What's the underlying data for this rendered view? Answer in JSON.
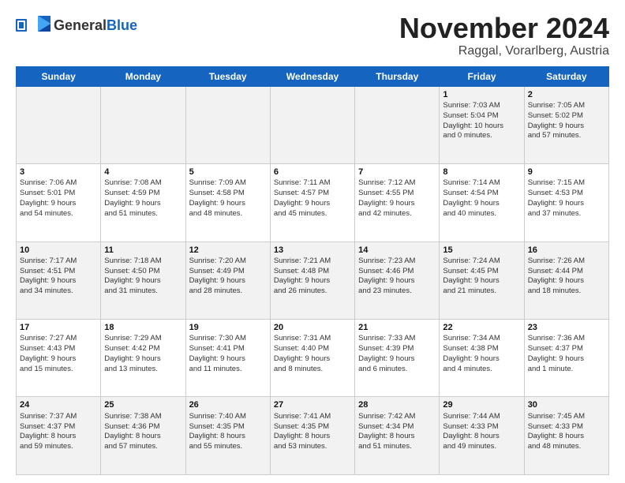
{
  "header": {
    "logo_general": "General",
    "logo_blue": "Blue",
    "month": "November 2024",
    "location": "Raggal, Vorarlberg, Austria"
  },
  "weekdays": [
    "Sunday",
    "Monday",
    "Tuesday",
    "Wednesday",
    "Thursday",
    "Friday",
    "Saturday"
  ],
  "weeks": [
    [
      {
        "day": "",
        "info": ""
      },
      {
        "day": "",
        "info": ""
      },
      {
        "day": "",
        "info": ""
      },
      {
        "day": "",
        "info": ""
      },
      {
        "day": "",
        "info": ""
      },
      {
        "day": "1",
        "info": "Sunrise: 7:03 AM\nSunset: 5:04 PM\nDaylight: 10 hours\nand 0 minutes."
      },
      {
        "day": "2",
        "info": "Sunrise: 7:05 AM\nSunset: 5:02 PM\nDaylight: 9 hours\nand 57 minutes."
      }
    ],
    [
      {
        "day": "3",
        "info": "Sunrise: 7:06 AM\nSunset: 5:01 PM\nDaylight: 9 hours\nand 54 minutes."
      },
      {
        "day": "4",
        "info": "Sunrise: 7:08 AM\nSunset: 4:59 PM\nDaylight: 9 hours\nand 51 minutes."
      },
      {
        "day": "5",
        "info": "Sunrise: 7:09 AM\nSunset: 4:58 PM\nDaylight: 9 hours\nand 48 minutes."
      },
      {
        "day": "6",
        "info": "Sunrise: 7:11 AM\nSunset: 4:57 PM\nDaylight: 9 hours\nand 45 minutes."
      },
      {
        "day": "7",
        "info": "Sunrise: 7:12 AM\nSunset: 4:55 PM\nDaylight: 9 hours\nand 42 minutes."
      },
      {
        "day": "8",
        "info": "Sunrise: 7:14 AM\nSunset: 4:54 PM\nDaylight: 9 hours\nand 40 minutes."
      },
      {
        "day": "9",
        "info": "Sunrise: 7:15 AM\nSunset: 4:53 PM\nDaylight: 9 hours\nand 37 minutes."
      }
    ],
    [
      {
        "day": "10",
        "info": "Sunrise: 7:17 AM\nSunset: 4:51 PM\nDaylight: 9 hours\nand 34 minutes."
      },
      {
        "day": "11",
        "info": "Sunrise: 7:18 AM\nSunset: 4:50 PM\nDaylight: 9 hours\nand 31 minutes."
      },
      {
        "day": "12",
        "info": "Sunrise: 7:20 AM\nSunset: 4:49 PM\nDaylight: 9 hours\nand 28 minutes."
      },
      {
        "day": "13",
        "info": "Sunrise: 7:21 AM\nSunset: 4:48 PM\nDaylight: 9 hours\nand 26 minutes."
      },
      {
        "day": "14",
        "info": "Sunrise: 7:23 AM\nSunset: 4:46 PM\nDaylight: 9 hours\nand 23 minutes."
      },
      {
        "day": "15",
        "info": "Sunrise: 7:24 AM\nSunset: 4:45 PM\nDaylight: 9 hours\nand 21 minutes."
      },
      {
        "day": "16",
        "info": "Sunrise: 7:26 AM\nSunset: 4:44 PM\nDaylight: 9 hours\nand 18 minutes."
      }
    ],
    [
      {
        "day": "17",
        "info": "Sunrise: 7:27 AM\nSunset: 4:43 PM\nDaylight: 9 hours\nand 15 minutes."
      },
      {
        "day": "18",
        "info": "Sunrise: 7:29 AM\nSunset: 4:42 PM\nDaylight: 9 hours\nand 13 minutes."
      },
      {
        "day": "19",
        "info": "Sunrise: 7:30 AM\nSunset: 4:41 PM\nDaylight: 9 hours\nand 11 minutes."
      },
      {
        "day": "20",
        "info": "Sunrise: 7:31 AM\nSunset: 4:40 PM\nDaylight: 9 hours\nand 8 minutes."
      },
      {
        "day": "21",
        "info": "Sunrise: 7:33 AM\nSunset: 4:39 PM\nDaylight: 9 hours\nand 6 minutes."
      },
      {
        "day": "22",
        "info": "Sunrise: 7:34 AM\nSunset: 4:38 PM\nDaylight: 9 hours\nand 4 minutes."
      },
      {
        "day": "23",
        "info": "Sunrise: 7:36 AM\nSunset: 4:37 PM\nDaylight: 9 hours\nand 1 minute."
      }
    ],
    [
      {
        "day": "24",
        "info": "Sunrise: 7:37 AM\nSunset: 4:37 PM\nDaylight: 8 hours\nand 59 minutes."
      },
      {
        "day": "25",
        "info": "Sunrise: 7:38 AM\nSunset: 4:36 PM\nDaylight: 8 hours\nand 57 minutes."
      },
      {
        "day": "26",
        "info": "Sunrise: 7:40 AM\nSunset: 4:35 PM\nDaylight: 8 hours\nand 55 minutes."
      },
      {
        "day": "27",
        "info": "Sunrise: 7:41 AM\nSunset: 4:35 PM\nDaylight: 8 hours\nand 53 minutes."
      },
      {
        "day": "28",
        "info": "Sunrise: 7:42 AM\nSunset: 4:34 PM\nDaylight: 8 hours\nand 51 minutes."
      },
      {
        "day": "29",
        "info": "Sunrise: 7:44 AM\nSunset: 4:33 PM\nDaylight: 8 hours\nand 49 minutes."
      },
      {
        "day": "30",
        "info": "Sunrise: 7:45 AM\nSunset: 4:33 PM\nDaylight: 8 hours\nand 48 minutes."
      }
    ]
  ]
}
